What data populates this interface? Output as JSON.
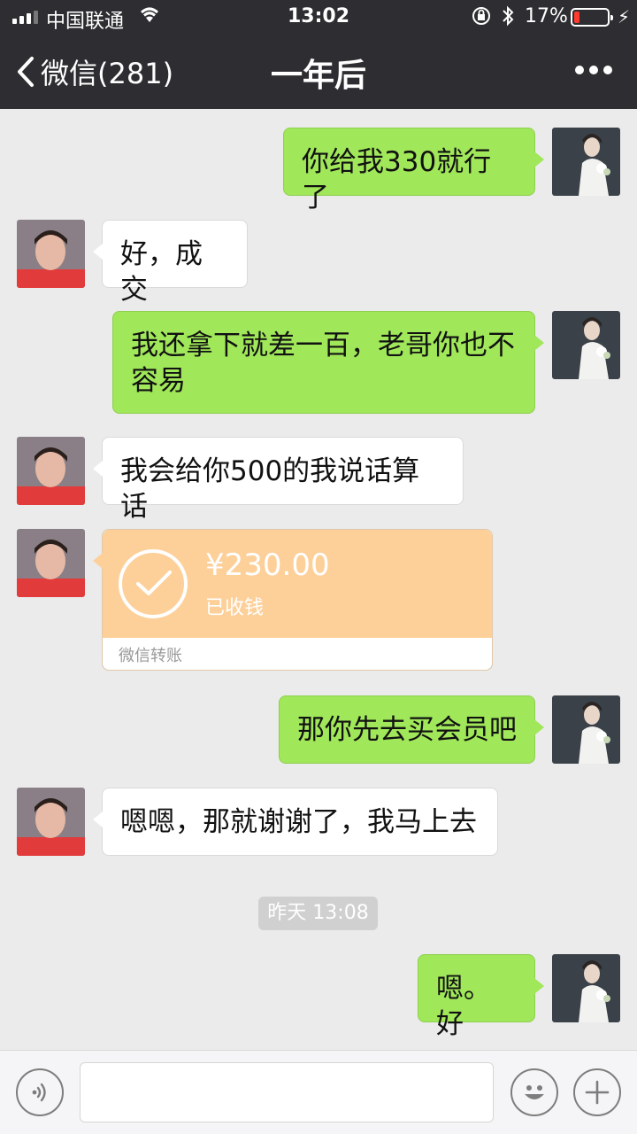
{
  "status_bar": {
    "carrier": "中国联通",
    "time": "13:02",
    "battery_percent": "17%",
    "battery_level": 0.17
  },
  "nav": {
    "back_label": "微信(281)",
    "title": "一年后"
  },
  "messages": [
    {
      "side": "right",
      "text": "你给我330就行了"
    },
    {
      "side": "left",
      "text": "好，成交"
    },
    {
      "side": "right",
      "text": "我还拿下就差一百，老哥你也不容易"
    },
    {
      "side": "left",
      "text": "我会给你500的我说话算话"
    },
    {
      "side": "left",
      "type": "transfer",
      "amount": "¥230.00",
      "status": "已收钱",
      "footer": "微信转账"
    },
    {
      "side": "right",
      "text": "那你先去买会员吧"
    },
    {
      "side": "left",
      "text": "嗯嗯，那就谢谢了，我马上去"
    },
    {
      "side": "right",
      "text": "嗯。好"
    }
  ],
  "timestamp": "昨天 13:08",
  "icons": {
    "back": "chevron-left-icon",
    "more": "more-dots-icon",
    "voice": "voice-icon",
    "emoji": "emoji-icon",
    "plus": "plus-icon",
    "transfer": "check-circle-icon"
  },
  "colors": {
    "header_bg": "#2e2e32",
    "my_bubble": "#a0e75a",
    "their_bubble": "#ffffff",
    "transfer_bg": "#fdd09a",
    "chat_bg": "#ebebeb"
  }
}
